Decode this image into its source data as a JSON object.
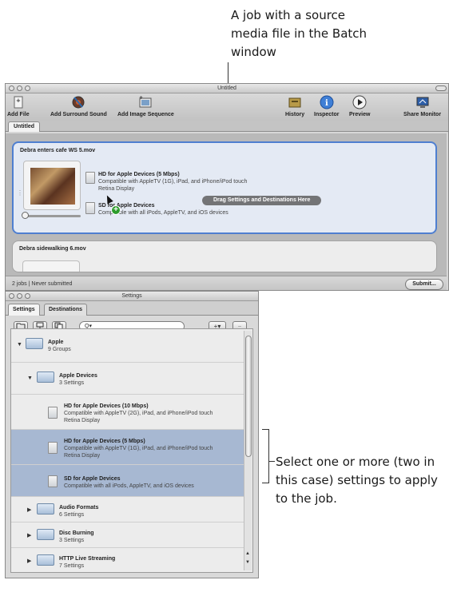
{
  "annotations": {
    "top": "A job with a source media file in the Batch window",
    "right": "Select one or more (two in this case) settings to apply to the job."
  },
  "main_window": {
    "title": "Untitled",
    "toolbar": {
      "add_file": "Add File",
      "add_surround": "Add Surround Sound",
      "add_image_sequence": "Add Image Sequence",
      "history": "History",
      "inspector": "Inspector",
      "preview": "Preview",
      "share_monitor": "Share Monitor"
    },
    "tab": "Untitled",
    "jobs": [
      {
        "title": "Debra enters cafe WS 5.mov",
        "settings": [
          {
            "name": "HD for Apple Devices (5 Mbps)",
            "line1": "Compatible with AppleTV (1G), iPad, and iPhone/iPod touch",
            "line2": "Retina Display"
          },
          {
            "name": "SD for Apple Devices",
            "line1": "Compatible with all iPods, AppleTV, and iOS devices"
          }
        ],
        "drop_hint": "Drag Settings and Destinations Here"
      },
      {
        "title": "Debra sidewalking 6.mov"
      }
    ],
    "status": "2 jobs  |  Never submitted",
    "submit": "Submit..."
  },
  "settings_window": {
    "title": "Settings",
    "tabs": [
      "Settings",
      "Destinations"
    ],
    "search_placeholder": "Q▾",
    "add_button": "+▾",
    "remove_button": "−",
    "rows": [
      {
        "title": "Apple",
        "sub": "9 Groups",
        "expanded": true
      },
      {
        "title": "Apple Devices",
        "sub": "3 Settings",
        "expanded": true
      },
      {
        "title": "HD for Apple Devices (10 Mbps)",
        "sub": "Compatible with AppleTV (2G), iPad, and iPhone/iPod touch",
        "sub2": "Retina Display",
        "selected": false
      },
      {
        "title": "HD for Apple Devices (5 Mbps)",
        "sub": "Compatible with AppleTV (1G), iPad, and iPhone/iPod touch",
        "sub2": "Retina Display",
        "selected": true
      },
      {
        "title": "SD for Apple Devices",
        "sub": "Compatible with all iPods, AppleTV, and iOS devices",
        "selected": true
      },
      {
        "title": "Audio Formats",
        "sub": "6 Settings",
        "expanded": false
      },
      {
        "title": "Disc Burning",
        "sub": "3 Settings",
        "expanded": false
      },
      {
        "title": "HTTP Live Streaming",
        "sub": "7 Settings",
        "expanded": false
      }
    ]
  },
  "colors": {
    "selection": "#a7b8d2",
    "job_highlight": "#4f7fd0",
    "plus_badge": "#2c9c2c"
  }
}
